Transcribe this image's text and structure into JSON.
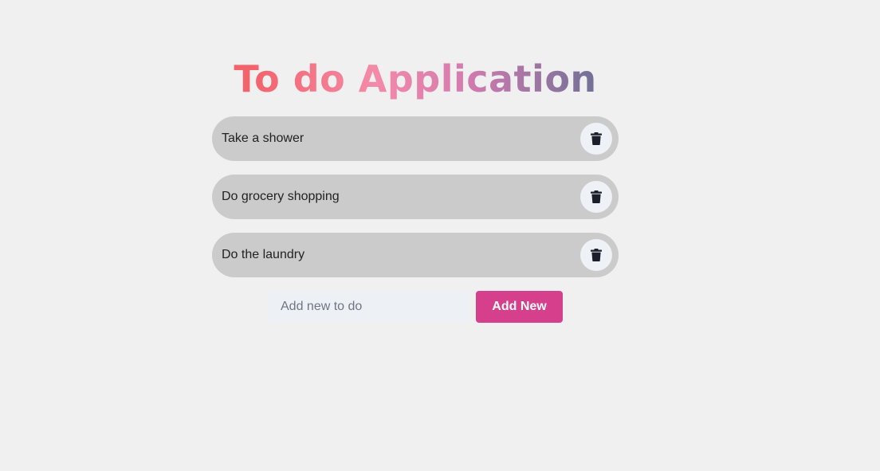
{
  "app": {
    "title": "To do Application",
    "accent_color": "#d63f8c",
    "title_gradient": [
      "#f3636b",
      "#f48aa8",
      "#d57bb0",
      "#5f6f93"
    ]
  },
  "todos": [
    {
      "text": "Take a shower",
      "delete_icon": "trash-icon"
    },
    {
      "text": "Do grocery shopping",
      "delete_icon": "trash-icon"
    },
    {
      "text": "Do the laundry",
      "delete_icon": "trash-icon"
    }
  ],
  "add_form": {
    "input_value": "",
    "placeholder": "Add new to do",
    "button_label": "Add New"
  }
}
